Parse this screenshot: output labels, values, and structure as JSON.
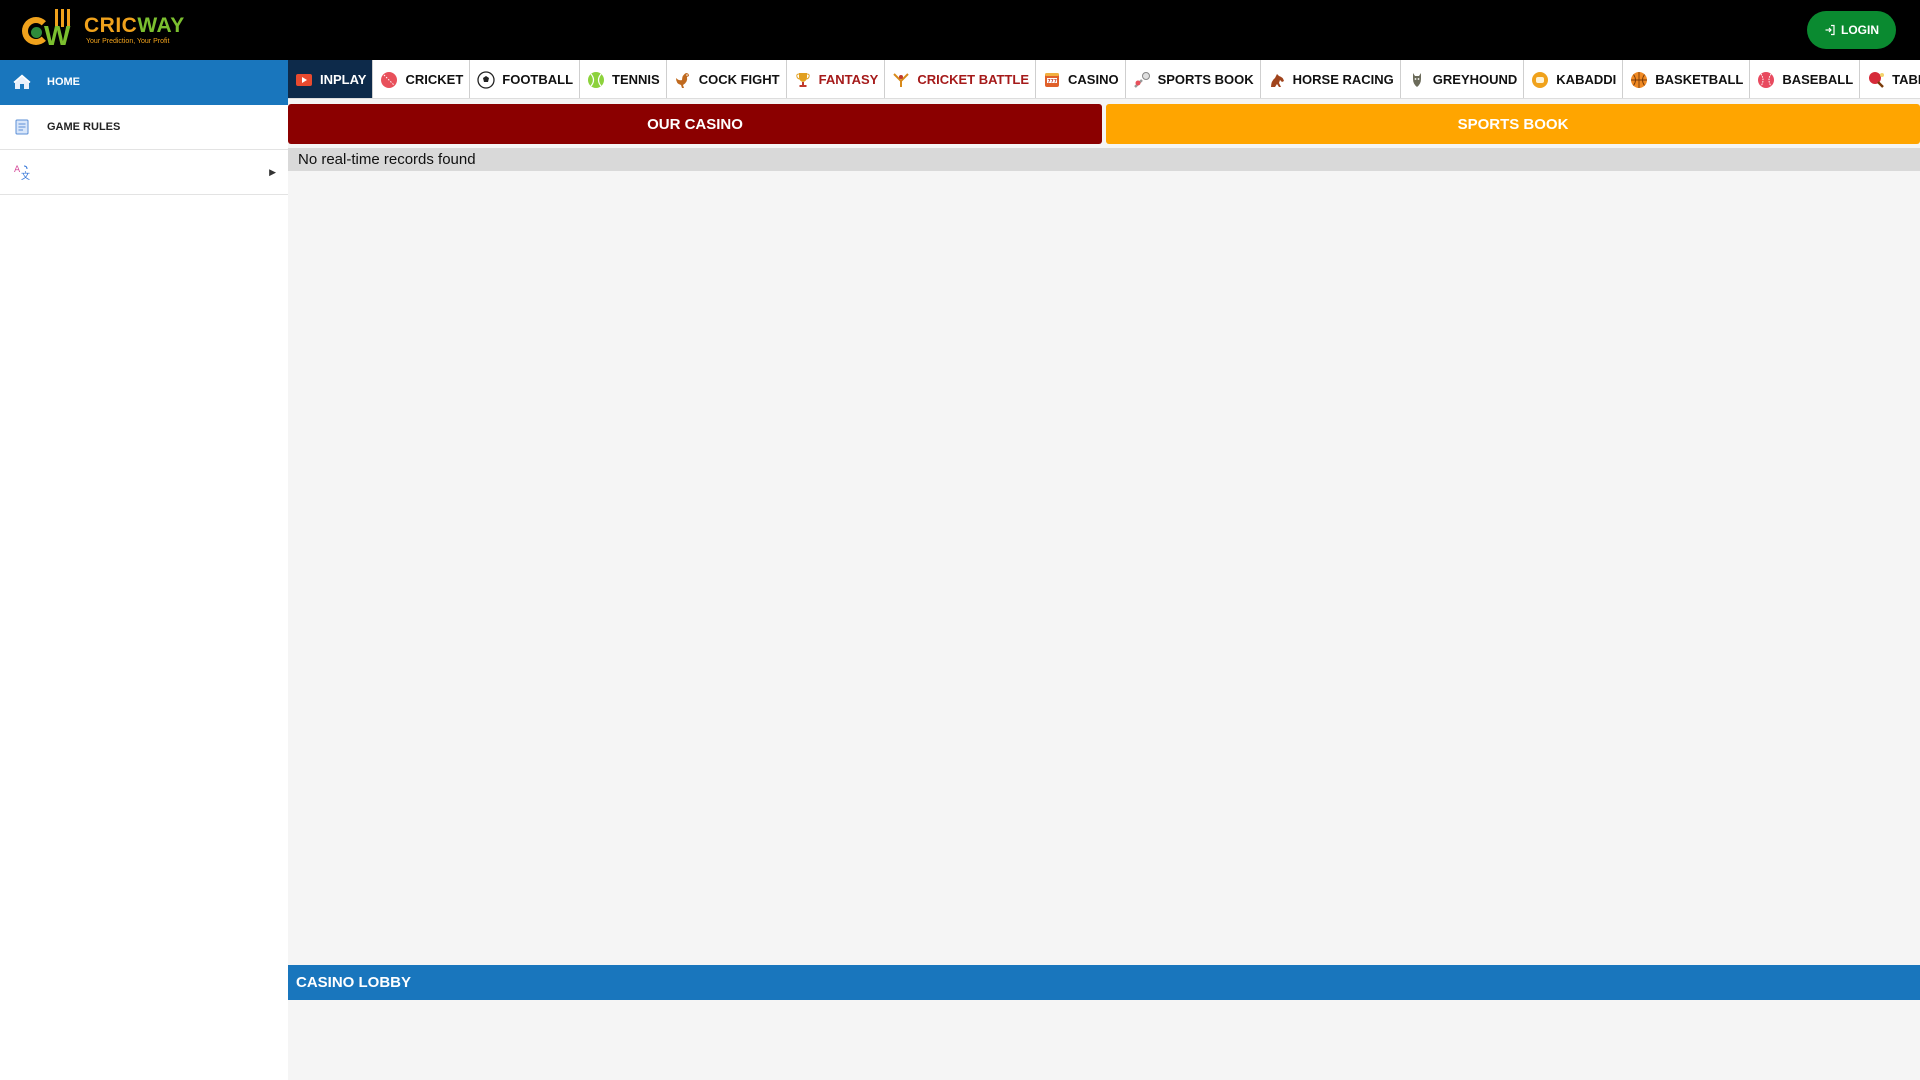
{
  "header": {
    "brand": {
      "name_part1": "CRIC",
      "name_part2": "WAY",
      "tagline": "Your Prediction, Your Profit"
    },
    "login_label": "LOGIN",
    "colors": {
      "background": "#000000",
      "login": "#0a8a30",
      "brand_orange": "#f0a21c",
      "brand_green": "#7bbf2f"
    }
  },
  "sidebar": {
    "items": [
      {
        "label": "HOME",
        "icon": "home-icon",
        "active": true
      },
      {
        "label": "GAME RULES",
        "icon": "rules-icon",
        "active": false
      },
      {
        "label": "",
        "icon": "language-icon",
        "active": false,
        "expandable": true
      }
    ],
    "active_color": "#1976bd"
  },
  "sports_nav": {
    "tabs": [
      {
        "label": "INPLAY",
        "icon": "inplay-icon",
        "active": true
      },
      {
        "label": "CRICKET",
        "icon": "cricket-ball-icon"
      },
      {
        "label": "FOOTBALL",
        "icon": "football-icon"
      },
      {
        "label": "TENNIS",
        "icon": "tennis-ball-icon"
      },
      {
        "label": "COCK FIGHT",
        "icon": "rooster-icon"
      },
      {
        "label": "FANTASY",
        "icon": "trophy-icon",
        "red": true
      },
      {
        "label": "CRICKET BATTLE",
        "icon": "cricket-battle-icon",
        "red": true
      },
      {
        "label": "CASINO",
        "icon": "casino-icon"
      },
      {
        "label": "SPORTS BOOK",
        "icon": "sports-book-icon"
      },
      {
        "label": "HORSE RACING",
        "icon": "horse-icon"
      },
      {
        "label": "GREYHOUND",
        "icon": "greyhound-icon"
      },
      {
        "label": "KABADDI",
        "icon": "kabaddi-icon"
      },
      {
        "label": "BASKETBALL",
        "icon": "basketball-icon"
      },
      {
        "label": "BASEBALL",
        "icon": "baseball-icon"
      },
      {
        "label": "TABLE TENNIS",
        "icon": "table-tennis-icon"
      }
    ],
    "active_color": "#0d2a4a"
  },
  "buttons": {
    "our_casino": "OUR CASINO",
    "sports_book": "SPORTS BOOK",
    "casino_color": "#8b0000",
    "sports_color": "#ffa500"
  },
  "main": {
    "empty_message": "No real-time records found"
  },
  "casino_lobby": {
    "title": "CASINO LOBBY",
    "color": "#1976bd"
  }
}
